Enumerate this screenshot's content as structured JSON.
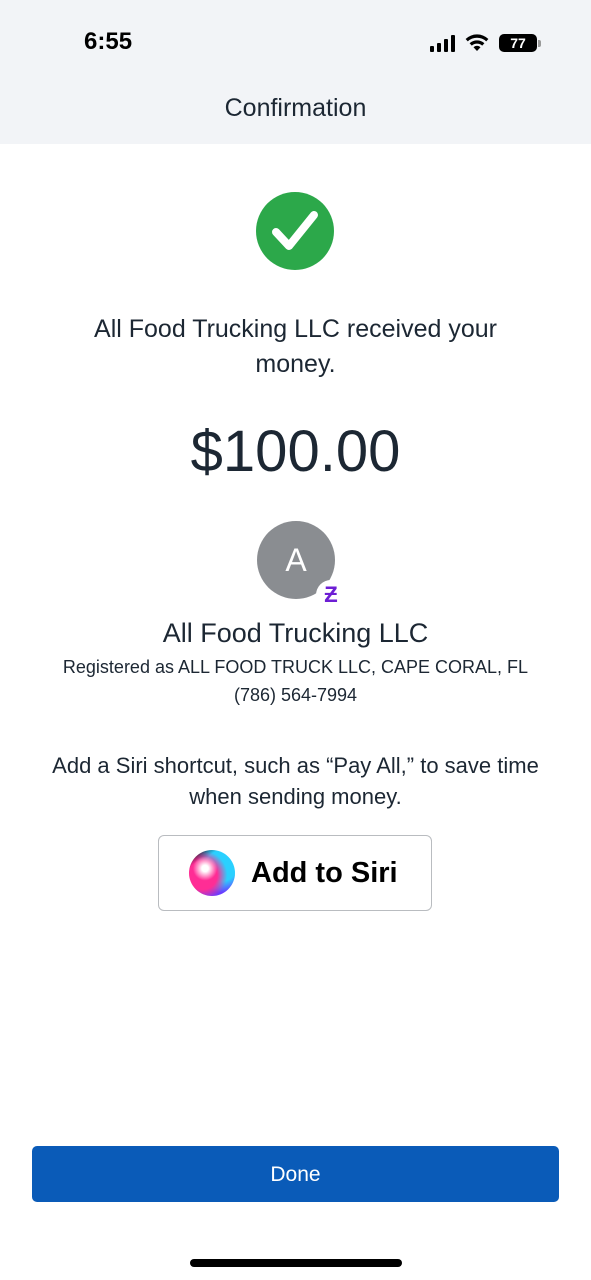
{
  "status_bar": {
    "time": "6:55",
    "battery": "77",
    "icons": [
      "signal-icon",
      "wifi-icon",
      "battery-icon"
    ]
  },
  "header": {
    "title": "Confirmation"
  },
  "confirmation": {
    "icon": "check-circle-icon",
    "icon_color": "#2ca84a",
    "message": "All Food Trucking LLC received your money.",
    "amount": "$100.00"
  },
  "recipient": {
    "avatar_letter": "A",
    "badge": "Ƶ",
    "badge_color": "#6d1ed4",
    "name": "All Food Trucking LLC",
    "registered": "Registered as ALL FOOD TRUCK LLC, CAPE CORAL, FL",
    "phone": "(786) 564-7994"
  },
  "siri": {
    "message": "Add a Siri shortcut, such as “Pay All,” to save time when sending money.",
    "button_label": "Add to Siri",
    "icon": "siri-icon"
  },
  "footer": {
    "done_label": "Done",
    "done_color": "#0a5bb8"
  }
}
